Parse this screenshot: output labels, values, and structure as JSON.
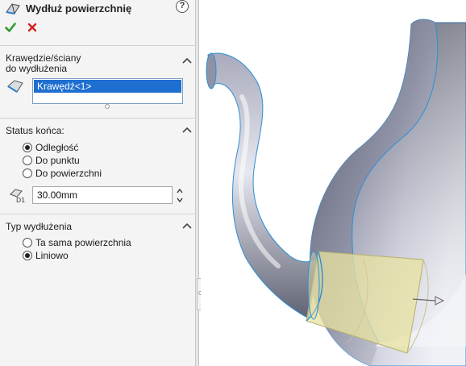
{
  "property_manager": {
    "title": "Wydłuż powierzchnię",
    "help_glyph": "?",
    "ok_icon": "checkmark-icon",
    "cancel_icon": "x-icon"
  },
  "groups": {
    "edges": {
      "title_line1": "Krawędzie/ściany",
      "title_line2": "do wydłużenia",
      "selection": [
        "Krawędź<1>"
      ]
    },
    "end_condition": {
      "title": "Status końca:",
      "options": [
        "Odległość",
        "Do punktu",
        "Do powierzchni"
      ],
      "selected": "Odległość",
      "distance_value": "30.00mm"
    },
    "extension_type": {
      "title": "Typ wydłużenia",
      "options": [
        "Ta sama powierzchnia",
        "Liniowo"
      ],
      "selected": "Liniowo"
    }
  },
  "colors": {
    "selection_highlight": "#1f6fd1",
    "ok_green": "#2f9a2f",
    "cancel_red": "#d42020",
    "preview_yellow": "#e8e3a0",
    "model_edge_blue": "#2d8fd6"
  }
}
